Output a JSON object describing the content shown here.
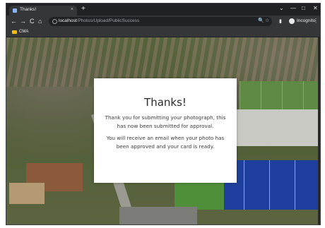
{
  "browser": {
    "tab_title": "Thanks!",
    "tab_close": "×",
    "new_tab": "+",
    "window_controls": {
      "chevron": "⌄",
      "minimize": "—",
      "maximize": "□",
      "close": "✕"
    },
    "nav": {
      "back": "←",
      "forward": "→",
      "reload": "C",
      "home": "⌂"
    },
    "url_host": "localhost",
    "url_path": "/Photos/Upload/PublicSuccess",
    "omnibox_icons": {
      "zoom": "🔍",
      "star": "☆"
    },
    "profile_label": "Incognito",
    "menu": "⋮",
    "bookmark_label": "CMA"
  },
  "page": {
    "heading": "Thanks!",
    "line1": "Thank you for submitting your photograph, this has now been submitted for approval.",
    "line2": "You will receive an email when your photo has been approved and your card is ready."
  },
  "colors": {
    "browser_frame": "#202124",
    "toolbar": "#35363a",
    "card_background": "#ffffff",
    "court_blue": "#1f3f9e"
  }
}
